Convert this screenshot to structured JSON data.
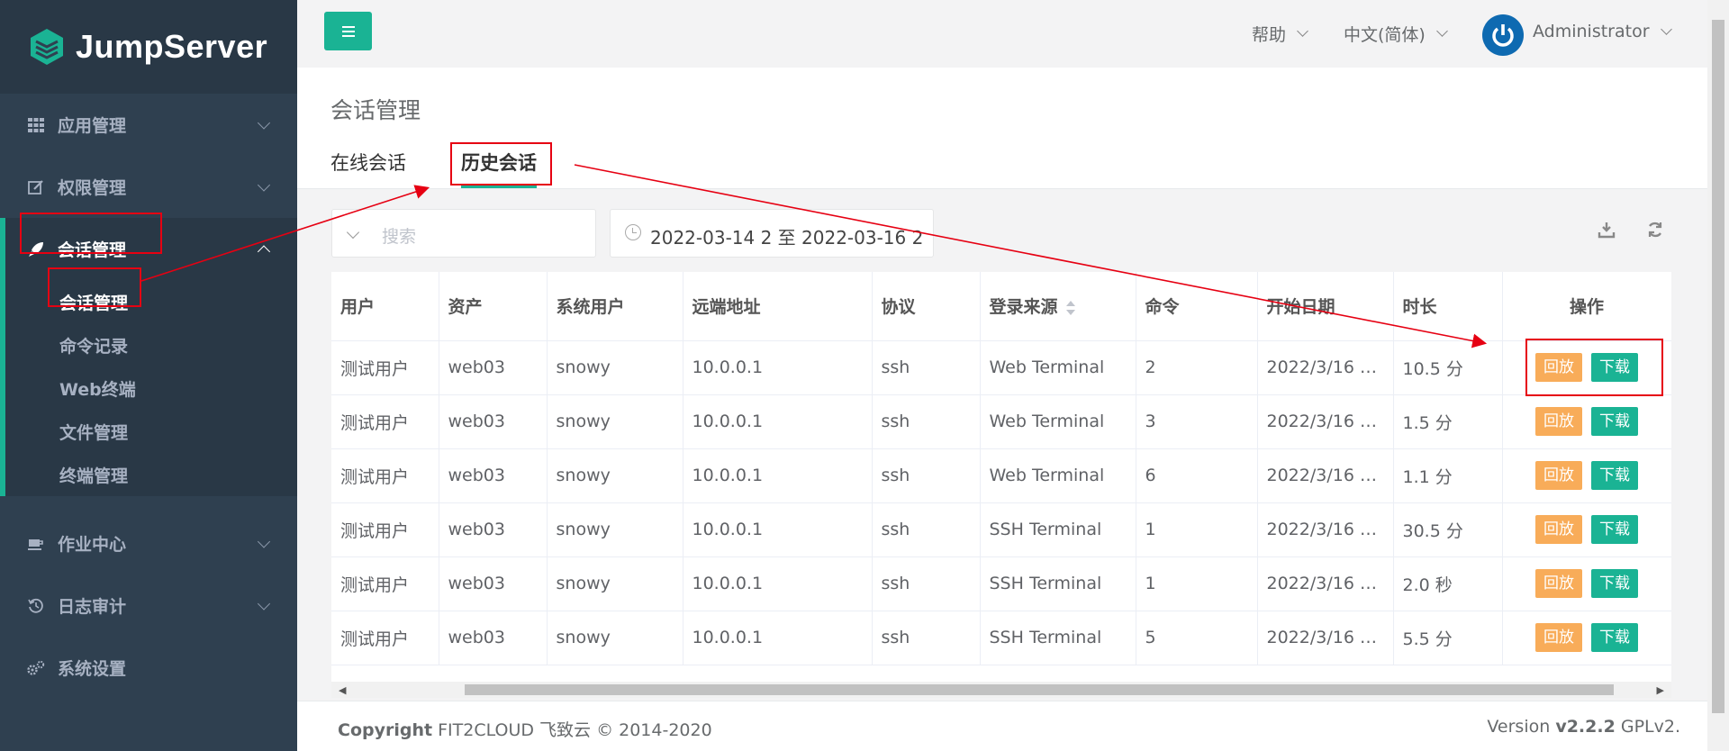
{
  "app": {
    "logo_text": "JumpServer"
  },
  "sidebar": {
    "items": [
      {
        "label": "应用管理",
        "icon": "grid-icon"
      },
      {
        "label": "权限管理",
        "icon": "edit-icon"
      },
      {
        "label": "会话管理",
        "icon": "rocket-icon",
        "active": true
      },
      {
        "label": "作业中心",
        "icon": "coffee-icon"
      },
      {
        "label": "日志审计",
        "icon": "history-icon"
      },
      {
        "label": "系统设置",
        "icon": "gears-icon"
      }
    ],
    "sub_items": [
      "会话管理",
      "命令记录",
      "Web终端",
      "文件管理",
      "终端管理"
    ]
  },
  "topbar": {
    "help": "帮助",
    "language": "中文(简体)",
    "user": "Administrator"
  },
  "page": {
    "title": "会话管理",
    "tabs": [
      "在线会话",
      "历史会话"
    ]
  },
  "filters": {
    "search_placeholder": "搜索",
    "date_range": "2022-03-14 2 至 2022-03-16 2"
  },
  "table": {
    "columns": [
      "用户",
      "资产",
      "系统用户",
      "远端地址",
      "协议",
      "登录来源",
      "命令",
      "开始日期",
      "时长",
      "操作"
    ],
    "rows": [
      [
        "测试用户",
        "web03",
        "snowy",
        "10.0.0.1",
        "ssh",
        "Web Terminal",
        "2",
        "2022/3/16 …",
        "10.5 分"
      ],
      [
        "测试用户",
        "web03",
        "snowy",
        "10.0.0.1",
        "ssh",
        "Web Terminal",
        "3",
        "2022/3/16 …",
        "1.5 分"
      ],
      [
        "测试用户",
        "web03",
        "snowy",
        "10.0.0.1",
        "ssh",
        "Web Terminal",
        "6",
        "2022/3/16 …",
        "1.1 分"
      ],
      [
        "测试用户",
        "web03",
        "snowy",
        "10.0.0.1",
        "ssh",
        "SSH Terminal",
        "1",
        "2022/3/16 …",
        "30.5 分"
      ],
      [
        "测试用户",
        "web03",
        "snowy",
        "10.0.0.1",
        "ssh",
        "SSH Terminal",
        "1",
        "2022/3/16 …",
        "2.0 秒"
      ],
      [
        "测试用户",
        "web03",
        "snowy",
        "10.0.0.1",
        "ssh",
        "SSH Terminal",
        "5",
        "2022/3/16 …",
        "5.5 分"
      ]
    ],
    "actions": {
      "replay": "回放",
      "download": "下载"
    }
  },
  "footer": {
    "copyright_bold": "Copyright",
    "copyright_rest": " FIT2CLOUD 飞致云 © 2014-2020",
    "version_prefix": "Version ",
    "version": "v2.2.2",
    "license": " GPLv2."
  },
  "colors": {
    "primary": "#1ab394",
    "warning": "#f8ac59",
    "sidebar": "#2f4050",
    "annotation": "#e60012"
  }
}
